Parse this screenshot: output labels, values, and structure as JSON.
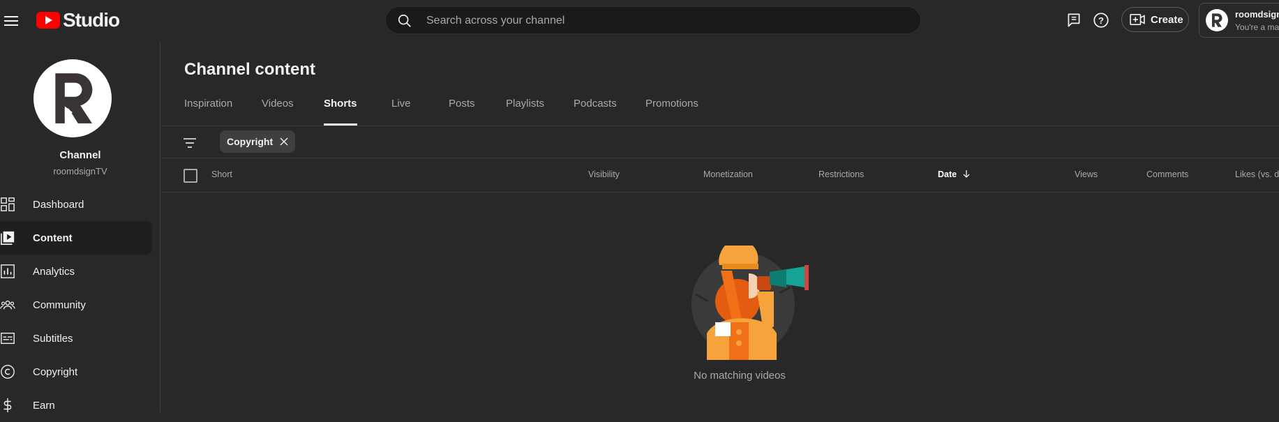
{
  "app": {
    "logo_text": "Studio"
  },
  "search": {
    "placeholder": "Search across your channel"
  },
  "header": {
    "create_label": "Create"
  },
  "account": {
    "name": "roomdsignTV",
    "subtitle": "You're a manager"
  },
  "channel": {
    "title": "Channel",
    "handle": "roomdsignTV"
  },
  "sidebar": {
    "items": [
      {
        "label": "Dashboard",
        "icon": "dashboard-icon"
      },
      {
        "label": "Content",
        "icon": "content-icon",
        "active": true
      },
      {
        "label": "Analytics",
        "icon": "analytics-icon"
      },
      {
        "label": "Community",
        "icon": "community-icon"
      },
      {
        "label": "Subtitles",
        "icon": "subtitles-icon"
      },
      {
        "label": "Copyright",
        "icon": "copyright-icon"
      },
      {
        "label": "Earn",
        "icon": "earn-icon"
      }
    ]
  },
  "main": {
    "title": "Channel content",
    "tabs": [
      {
        "label": "Inspiration"
      },
      {
        "label": "Videos"
      },
      {
        "label": "Shorts",
        "active": true
      },
      {
        "label": "Live"
      },
      {
        "label": "Posts"
      },
      {
        "label": "Playlists"
      },
      {
        "label": "Podcasts"
      },
      {
        "label": "Promotions"
      }
    ],
    "filter_chip": {
      "label": "Copyright"
    },
    "columns": {
      "short": "Short",
      "visibility": "Visibility",
      "monetization": "Monetization",
      "restrictions": "Restrictions",
      "date": "Date",
      "views": "Views",
      "comments": "Comments",
      "likes": "Likes (vs. dislikes)"
    },
    "empty_message": "No matching videos"
  },
  "colors": {
    "background": "#282828",
    "brand_red": "#ff0000",
    "text": "#f1f1f1",
    "muted": "#aaaaaa"
  }
}
